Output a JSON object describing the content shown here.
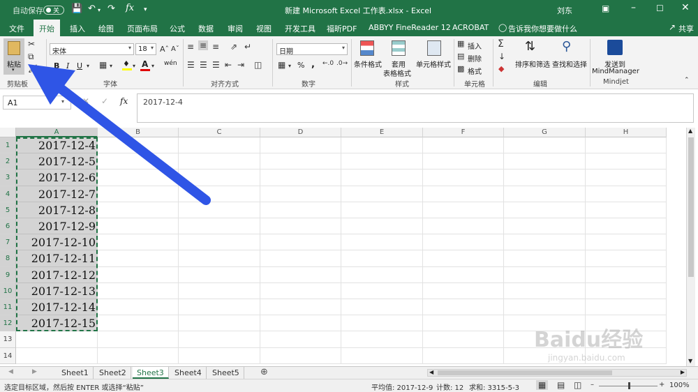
{
  "titlebar": {
    "autosave": "自动保存",
    "autosave_state": "关",
    "title": "新建 Microsoft Excel 工作表.xlsx - Excel",
    "user": "刘东"
  },
  "tabs": [
    "文件",
    "开始",
    "插入",
    "绘图",
    "页面布局",
    "公式",
    "数据",
    "审阅",
    "视图",
    "开发工具",
    "福昕PDF",
    "ABBYY FineReader 12",
    "ACROBAT"
  ],
  "tell_me": "告诉我你想要做什么",
  "share": "共享",
  "ribbon": {
    "paste": "粘贴",
    "font_name": "宋体",
    "font_size": "18",
    "number_format": "日期",
    "bold": "B",
    "italic": "I",
    "underline": "U",
    "wen": "wén",
    "percent": "%",
    "comma": ",",
    "cond_format": "条件格式",
    "table_format_1": "套用",
    "table_format_2": "表格格式",
    "cell_style": "单元格样式",
    "insert": "插入",
    "delete": "删除",
    "format": "格式",
    "sort_filter": "排序和筛选",
    "find_select": "查找和选择",
    "send_1": "发送到",
    "send_2": "MindManager",
    "groups": [
      "剪贴板",
      "字体",
      "对齐方式",
      "数字",
      "样式",
      "单元格",
      "编辑",
      "Mindjet"
    ]
  },
  "formula_bar": {
    "name_box": "A1",
    "fx": "fx",
    "content": "2017-12-4"
  },
  "columns": [
    "A",
    "B",
    "C",
    "D",
    "E",
    "F",
    "G",
    "H"
  ],
  "rows": [
    "1",
    "2",
    "3",
    "4",
    "5",
    "6",
    "7",
    "8",
    "9",
    "10",
    "11",
    "12",
    "13",
    "14"
  ],
  "column_a": [
    "2017-12-4",
    "2017-12-5",
    "2017-12-6",
    "2017-12-7",
    "2017-12-8",
    "2017-12-9",
    "2017-12-10",
    "2017-12-11",
    "2017-12-12",
    "2017-12-13",
    "2017-12-14",
    "2017-12-15"
  ],
  "sheets": [
    "Sheet1",
    "Sheet2",
    "Sheet3",
    "Sheet4",
    "Sheet5"
  ],
  "active_sheet": "Sheet3",
  "status": {
    "message": "选定目标区域，然后按 ENTER 或选择“粘贴”",
    "average": "平均值: 2017-12-9",
    "count": "计数: 12",
    "sum": "求和: 3315-5-3",
    "zoom": "100%"
  },
  "watermark": {
    "brand": "Baidu经验",
    "url": "jingyan.baidu.com"
  },
  "colors": {
    "brand": "#217346",
    "arrow": "#2f55e6",
    "selection_fill": "#d4d4d4"
  }
}
